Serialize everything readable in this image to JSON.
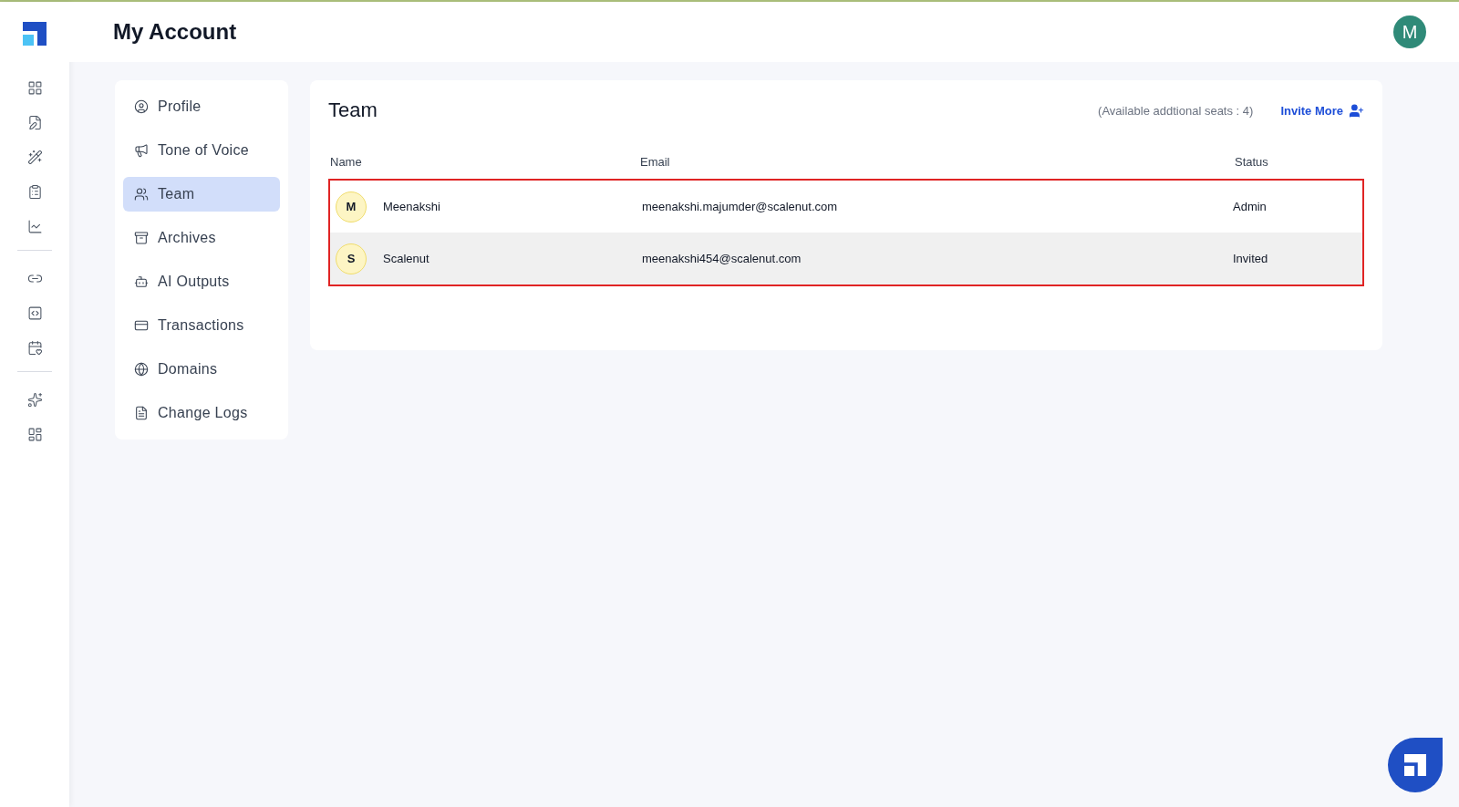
{
  "header": {
    "title": "My Account",
    "avatar_initial": "M"
  },
  "nav": [
    {
      "label": "Profile",
      "selected": false
    },
    {
      "label": "Tone of Voice",
      "selected": false
    },
    {
      "label": "Team",
      "selected": true
    },
    {
      "label": "Archives",
      "selected": false
    },
    {
      "label": "AI Outputs",
      "selected": false
    },
    {
      "label": "Transactions",
      "selected": false
    },
    {
      "label": "Domains",
      "selected": false
    },
    {
      "label": "Change Logs",
      "selected": false
    }
  ],
  "team": {
    "title": "Team",
    "seats_note": "(Available addtional seats : 4)",
    "invite_label": "Invite More",
    "columns": [
      "Name",
      "Email",
      "Status"
    ],
    "rows": [
      {
        "initial": "M",
        "name": "Meenakshi",
        "email": "meenakshi.majumder@scalenut.com",
        "status": "Admin",
        "highlighted": false
      },
      {
        "initial": "S",
        "name": "Scalenut",
        "email": "meenakshi454@scalenut.com",
        "status": "Invited",
        "highlighted": true
      }
    ],
    "outlined": true
  }
}
